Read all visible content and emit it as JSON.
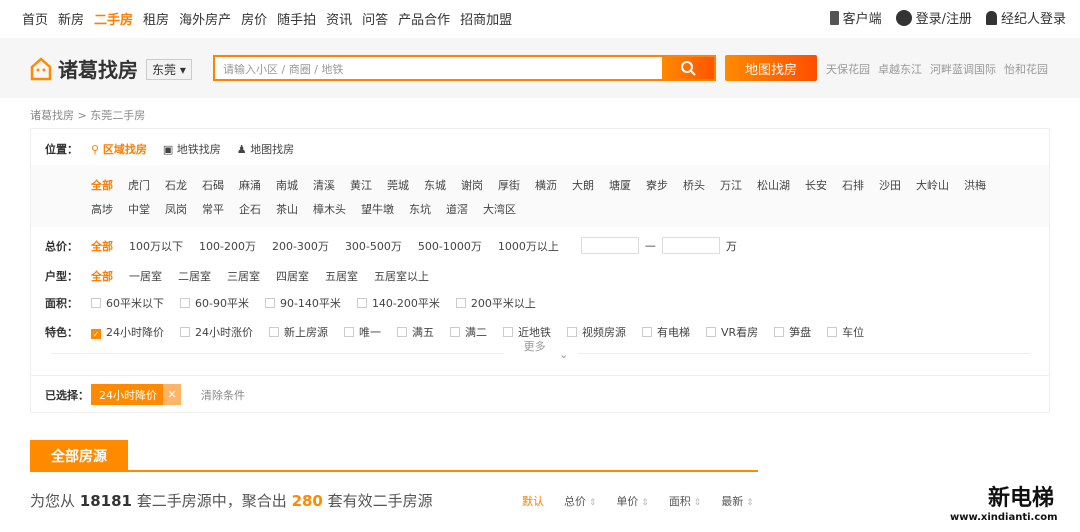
{
  "top_nav": {
    "items": [
      "首页",
      "新房",
      "二手房",
      "租房",
      "海外房产",
      "房价",
      "随手拍",
      "资讯",
      "问答",
      "产品合作",
      "招商加盟"
    ],
    "active_index": 2,
    "right": {
      "client": "客户端",
      "login": "登录/注册",
      "agent": "经纪人登录"
    }
  },
  "header": {
    "logo_text": "诸葛找房",
    "city": "东莞",
    "search_placeholder": "请输入小区 / 商圈 / 地铁",
    "map_button": "地图找房",
    "hot_searches": [
      "天保花园",
      "卓越东江",
      "河畔蓝调国际",
      "怡和花园"
    ]
  },
  "breadcrumb": "诸葛找房 > 东莞二手房",
  "filters": {
    "location": {
      "label": "位置：",
      "modes": [
        "区域找房",
        "地铁找房",
        "地图找房"
      ],
      "active": 0
    },
    "districts": [
      "全部",
      "虎门",
      "石龙",
      "石碣",
      "麻涌",
      "南城",
      "清溪",
      "黄江",
      "莞城",
      "东城",
      "谢岗",
      "厚街",
      "横沥",
      "大朗",
      "塘厦",
      "寮步",
      "桥头",
      "万江",
      "松山湖",
      "长安",
      "石排",
      "沙田",
      "大岭山",
      "洪梅",
      "高埗",
      "中堂",
      "凤岗",
      "常平",
      "企石",
      "茶山",
      "樟木头",
      "望牛墩",
      "东坑",
      "道滘",
      "大湾区"
    ],
    "price": {
      "label": "总价：",
      "options": [
        "全部",
        "100万以下",
        "100-200万",
        "200-300万",
        "300-500万",
        "500-1000万",
        "1000万以上"
      ],
      "unit": "万"
    },
    "layout": {
      "label": "户型：",
      "options": [
        "全部",
        "一居室",
        "二居室",
        "三居室",
        "四居室",
        "五居室",
        "五居室以上"
      ]
    },
    "area": {
      "label": "面积：",
      "options": [
        "60平米以下",
        "60-90平米",
        "90-140平米",
        "140-200平米",
        "200平米以上"
      ]
    },
    "feature": {
      "label": "特色：",
      "options": [
        "24小时降价",
        "24小时涨价",
        "新上房源",
        "唯一",
        "满五",
        "满二",
        "近地铁",
        "视频房源",
        "有电梯",
        "VR看房",
        "笋盘",
        "车位"
      ],
      "checked": [
        0
      ]
    },
    "more": "更多",
    "selected": {
      "label": "已选择：",
      "tags": [
        "24小时降价"
      ],
      "clear": "清除条件"
    }
  },
  "section": {
    "tab": "全部房源",
    "summary": {
      "pre": "为您从",
      "total": "18181",
      "mid": "套二手房源中，聚合出",
      "count": "280",
      "post": "套有效二手房源"
    },
    "sorts": [
      "默认",
      "总价",
      "单价",
      "面积",
      "最新"
    ]
  },
  "watermark": {
    "text": "新电梯",
    "url": "www.xindianti.com"
  },
  "colors": {
    "accent": "#ff8a00"
  }
}
